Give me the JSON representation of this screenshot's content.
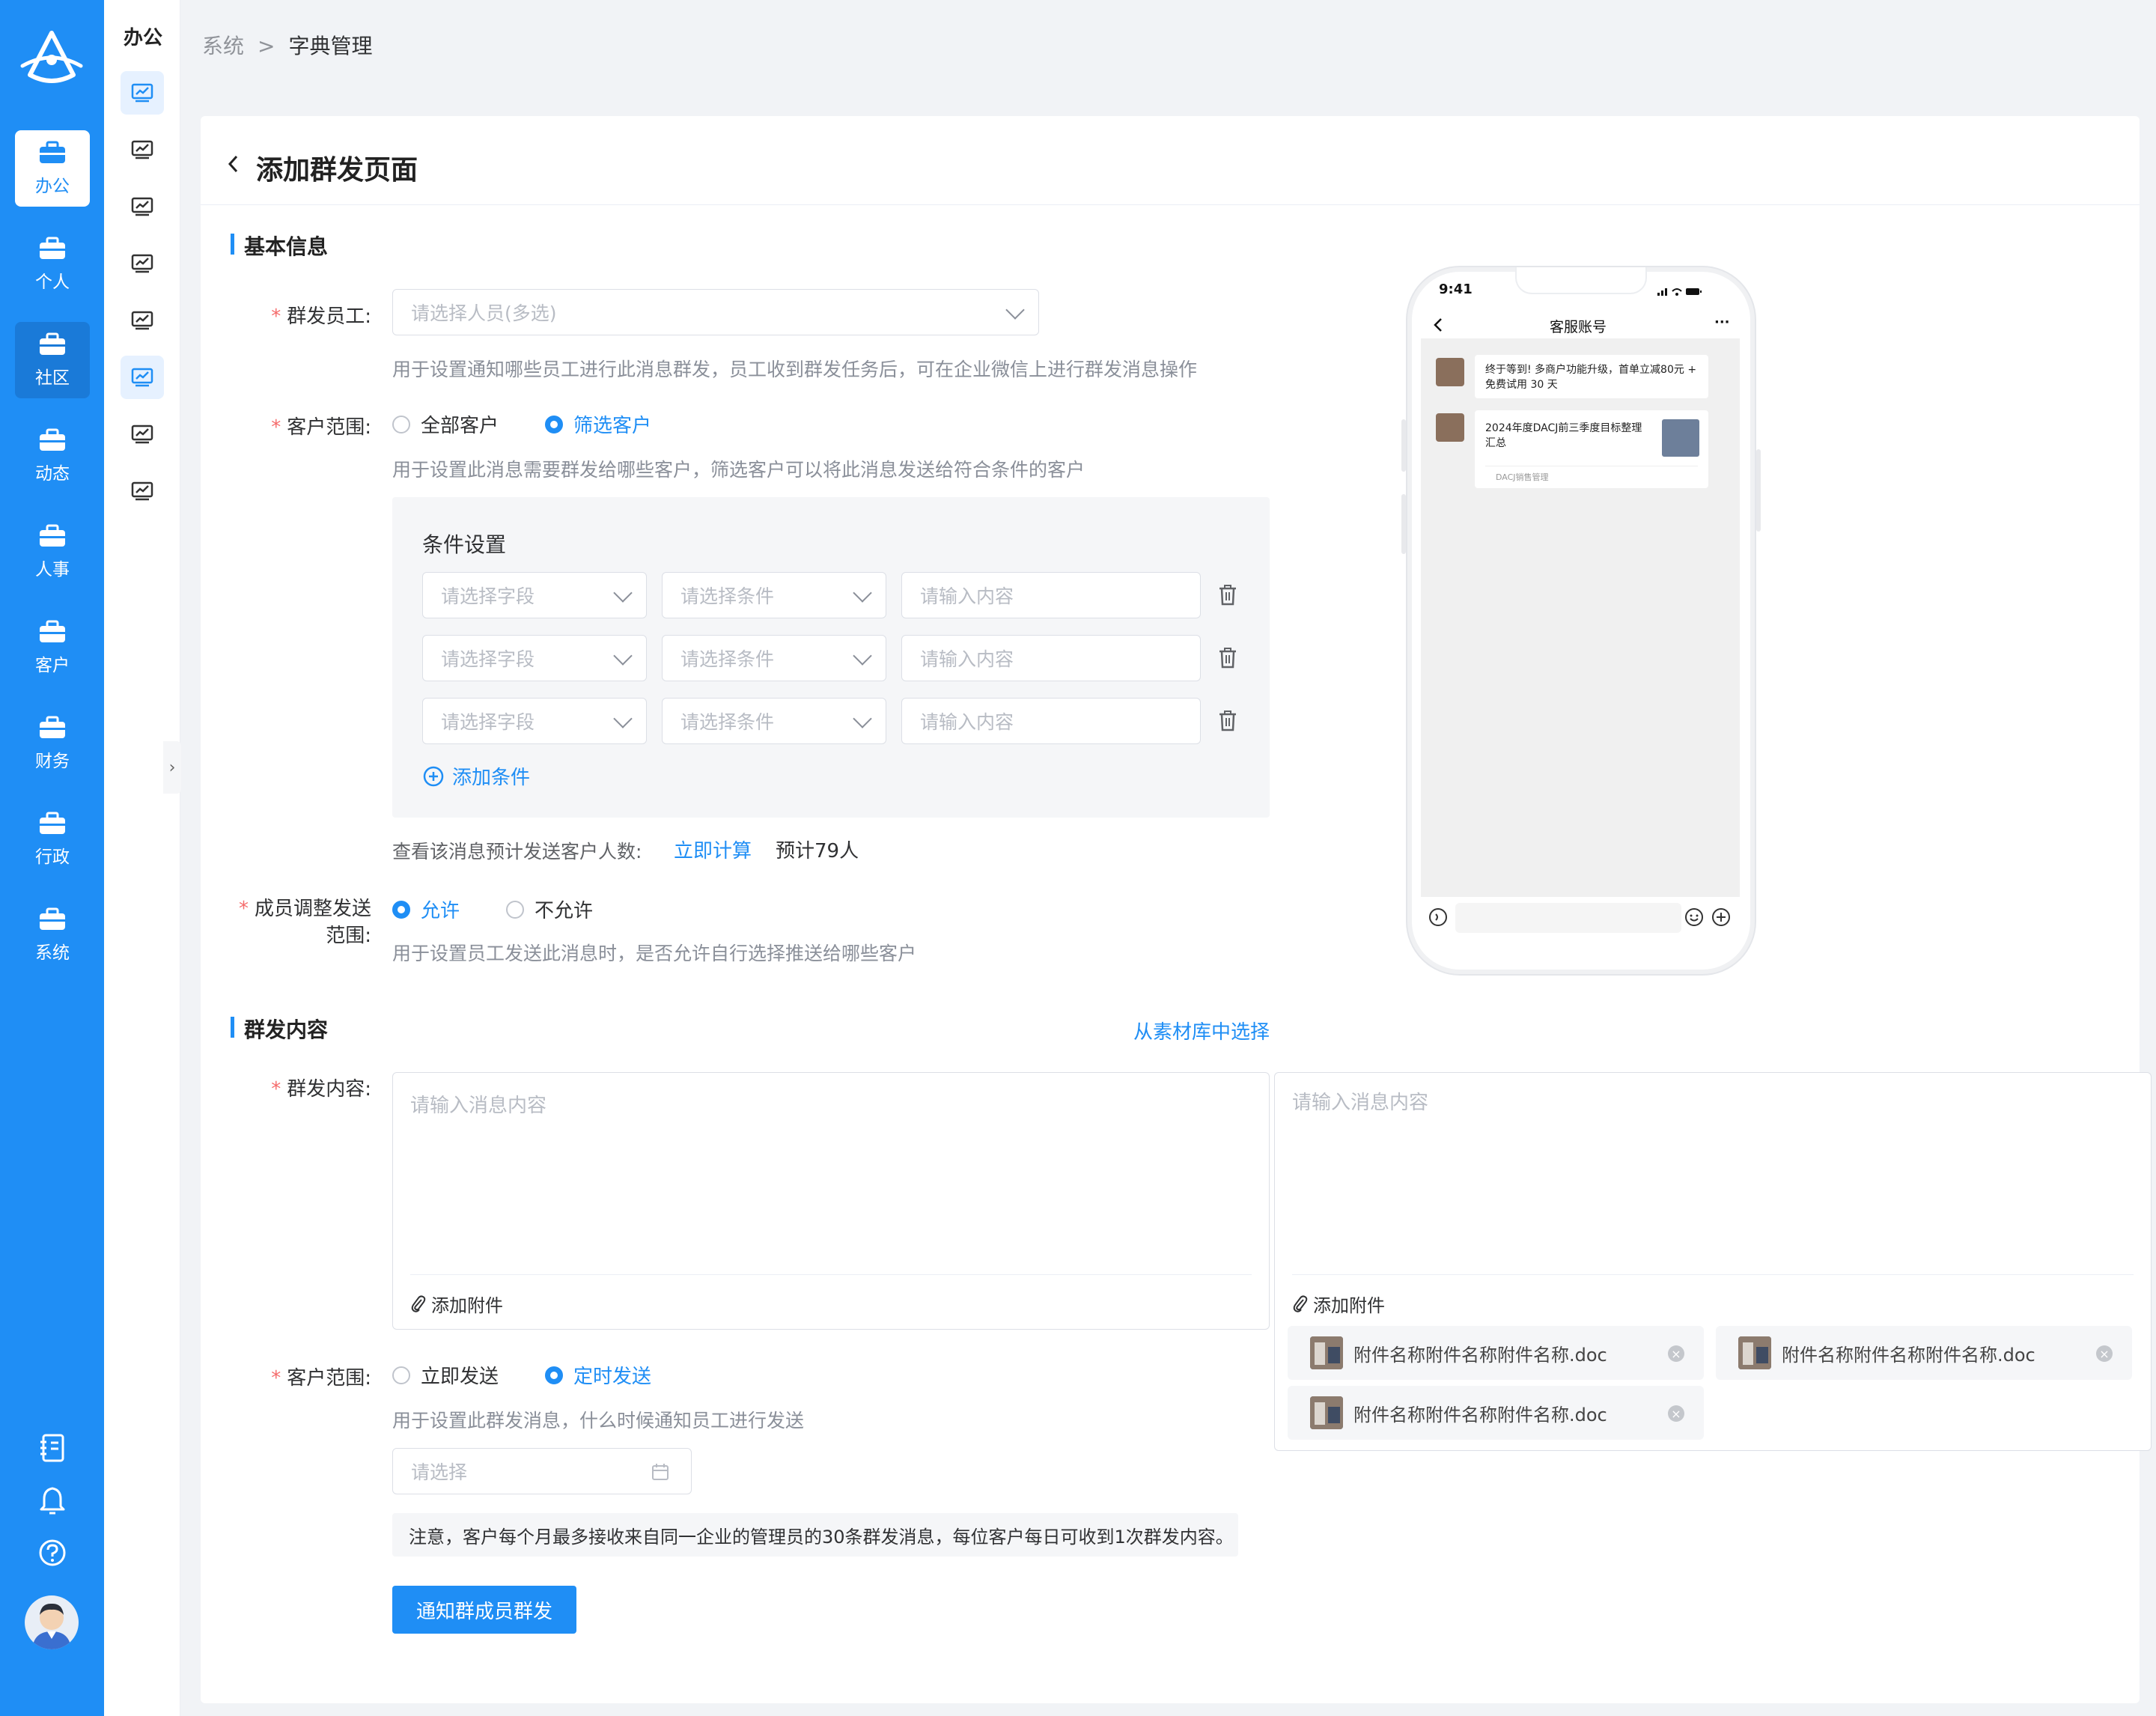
{
  "nav": {
    "items": [
      {
        "label": "办公",
        "icon": "briefcase-icon"
      },
      {
        "label": "个人",
        "icon": "briefcase-icon"
      },
      {
        "label": "社区",
        "icon": "briefcase-icon"
      },
      {
        "label": "动态",
        "icon": "briefcase-icon"
      },
      {
        "label": "人事",
        "icon": "briefcase-icon"
      },
      {
        "label": "客户",
        "icon": "briefcase-icon"
      },
      {
        "label": "财务",
        "icon": "briefcase-icon"
      },
      {
        "label": "行政",
        "icon": "briefcase-icon"
      },
      {
        "label": "系统",
        "icon": "briefcase-icon"
      }
    ],
    "active_color": "#1f8ef5"
  },
  "subnav": {
    "title": "办公"
  },
  "breadcrumb": {
    "root": "系统",
    "current": "字典管理"
  },
  "page": {
    "title": "添加群发页面"
  },
  "basic": {
    "section_title": "基本信息",
    "staff_label": "群发员工:",
    "staff_placeholder": "请选择人员(多选)",
    "staff_hint": "用于设置通知哪些员工进行此消息群发，员工收到群发任务后，可在企业微信上进行群发消息操作",
    "scope_label": "客户范围:",
    "scope_all": "全部客户",
    "scope_filter": "筛选客户",
    "scope_hint": "用于设置此消息需要群发给哪些客户，筛选客户可以将此消息发送给符合条件的客户",
    "cond_title": "条件设置",
    "cond_field_ph": "请选择字段",
    "cond_op_ph": "请选择条件",
    "cond_value_ph": "请输入内容",
    "add_condition": "添加条件",
    "preview_text": "查看该消息预计发送客户人数:",
    "calc_link": "立即计算",
    "estimate": "预计79人",
    "member_label_1": "成员调整发送",
    "member_label_2": "范围:",
    "allow": "允许",
    "disallow": "不允许",
    "member_hint": "用于设置员工发送此消息时，是否允许自行选择推送给哪些客户"
  },
  "content": {
    "section_title": "群发内容",
    "material_link": "从素材库中选择",
    "content_label": "群发内容:",
    "content_ph": "请输入消息内容",
    "add_attachment": "添加附件",
    "attachments": [
      "附件名称附件名称附件名称.doc",
      "附件名称附件名称附件名称.doc",
      "附件名称附件名称附件名称.doc"
    ],
    "send_label": "客户范围:",
    "send_now": "立即发送",
    "send_timed": "定时发送",
    "send_hint": "用于设置此群发消息，什么时候通知员工进行发送",
    "date_ph": "请选择",
    "notice": "注意，客户每个月最多接收来自同一企业的管理员的30条群发消息，每位客户每日可收到1次群发内容。",
    "submit": "通知群成员群发"
  },
  "phone": {
    "time": "9:41",
    "title": "客服账号",
    "msg1": "终于等到! 多商户功能升级，首单立减80元 + 免费试用 30 天",
    "msg2_title": "2024年度DACJ前三季度目标整理汇总",
    "msg2_source": "DACJ销售管理"
  }
}
